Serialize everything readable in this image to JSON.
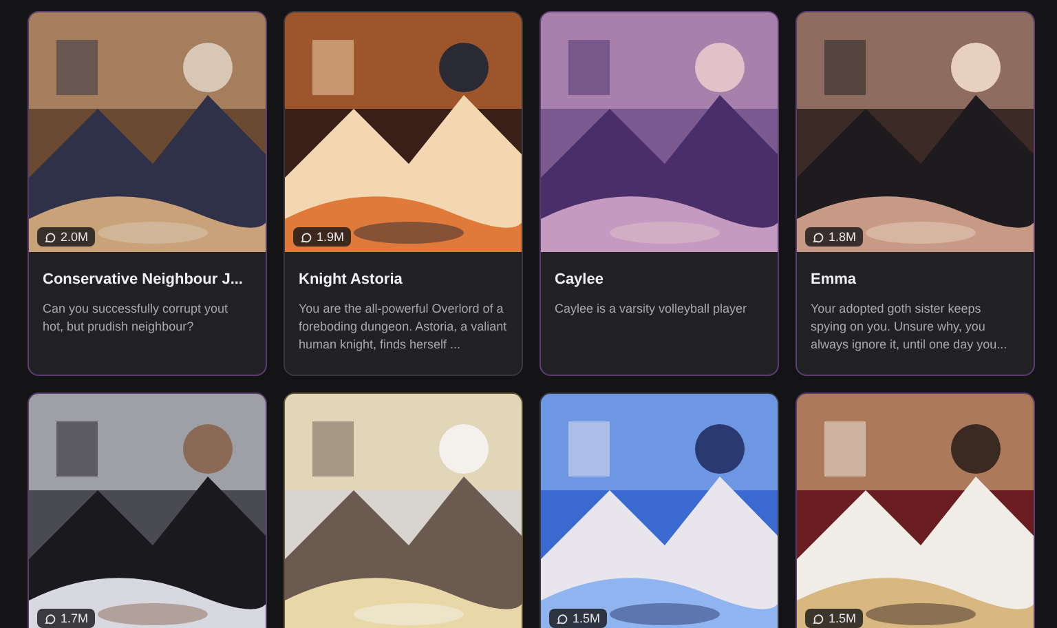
{
  "cards": [
    {
      "chats": "2.0M",
      "title": "Conservative Neighbour J...",
      "description": "Can you successfully corrupt yout hot, but prudish neighbour?",
      "color": "#5b3d6e"
    },
    {
      "chats": "1.9M",
      "title": "Knight Astoria",
      "description": "You are the all-powerful Overlord of a foreboding dungeon. Astoria, a valiant human knight, finds herself ...",
      "color": "#38383e"
    },
    {
      "title": "Caylee",
      "description": "Caylee is a varsity volleyball player",
      "color": "#5b3d6e"
    },
    {
      "chats": "1.8M",
      "title": "Emma",
      "description": "Your adopted goth sister keeps spying on you. Unsure why, you always ignore it, until one day you...",
      "color": "#5b3d6e"
    },
    {
      "chats": "1.7M",
      "color": "#5b3d6e"
    },
    {
      "color": "#5e5232"
    },
    {
      "chats": "1.5M",
      "color": "#38383e"
    },
    {
      "chats": "1.5M",
      "color": "#5b3d6e"
    }
  ]
}
